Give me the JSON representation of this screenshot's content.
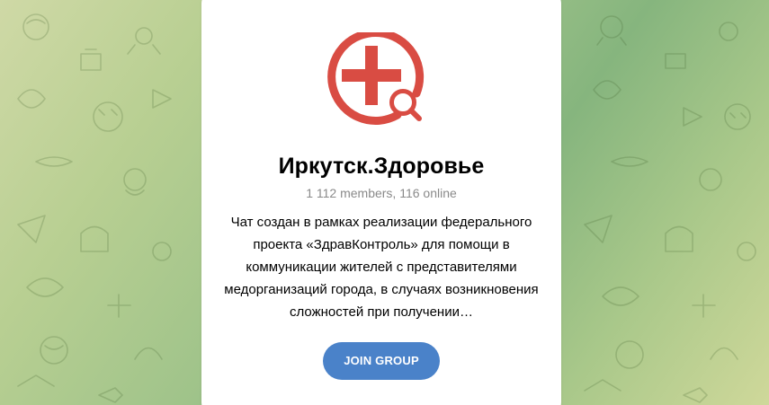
{
  "group": {
    "name": "Иркутск.Здоровье",
    "stats": "1 112 members, 116 online",
    "description": "Чат создан в рамках реализации федерального проекта «ЗдравКонтроль» для помощи в коммуникации жителей с представителями медорганизаций города, в случаях возникновения сложностей при получении…"
  },
  "actions": {
    "join_label": "JOIN GROUP"
  },
  "icons": {
    "logo": "medical-cross-search-icon",
    "background": "doodle-pattern"
  },
  "colors": {
    "logo_red": "#d94c43",
    "button_blue": "#4a82c9",
    "meta_gray": "#8a8a8a"
  }
}
